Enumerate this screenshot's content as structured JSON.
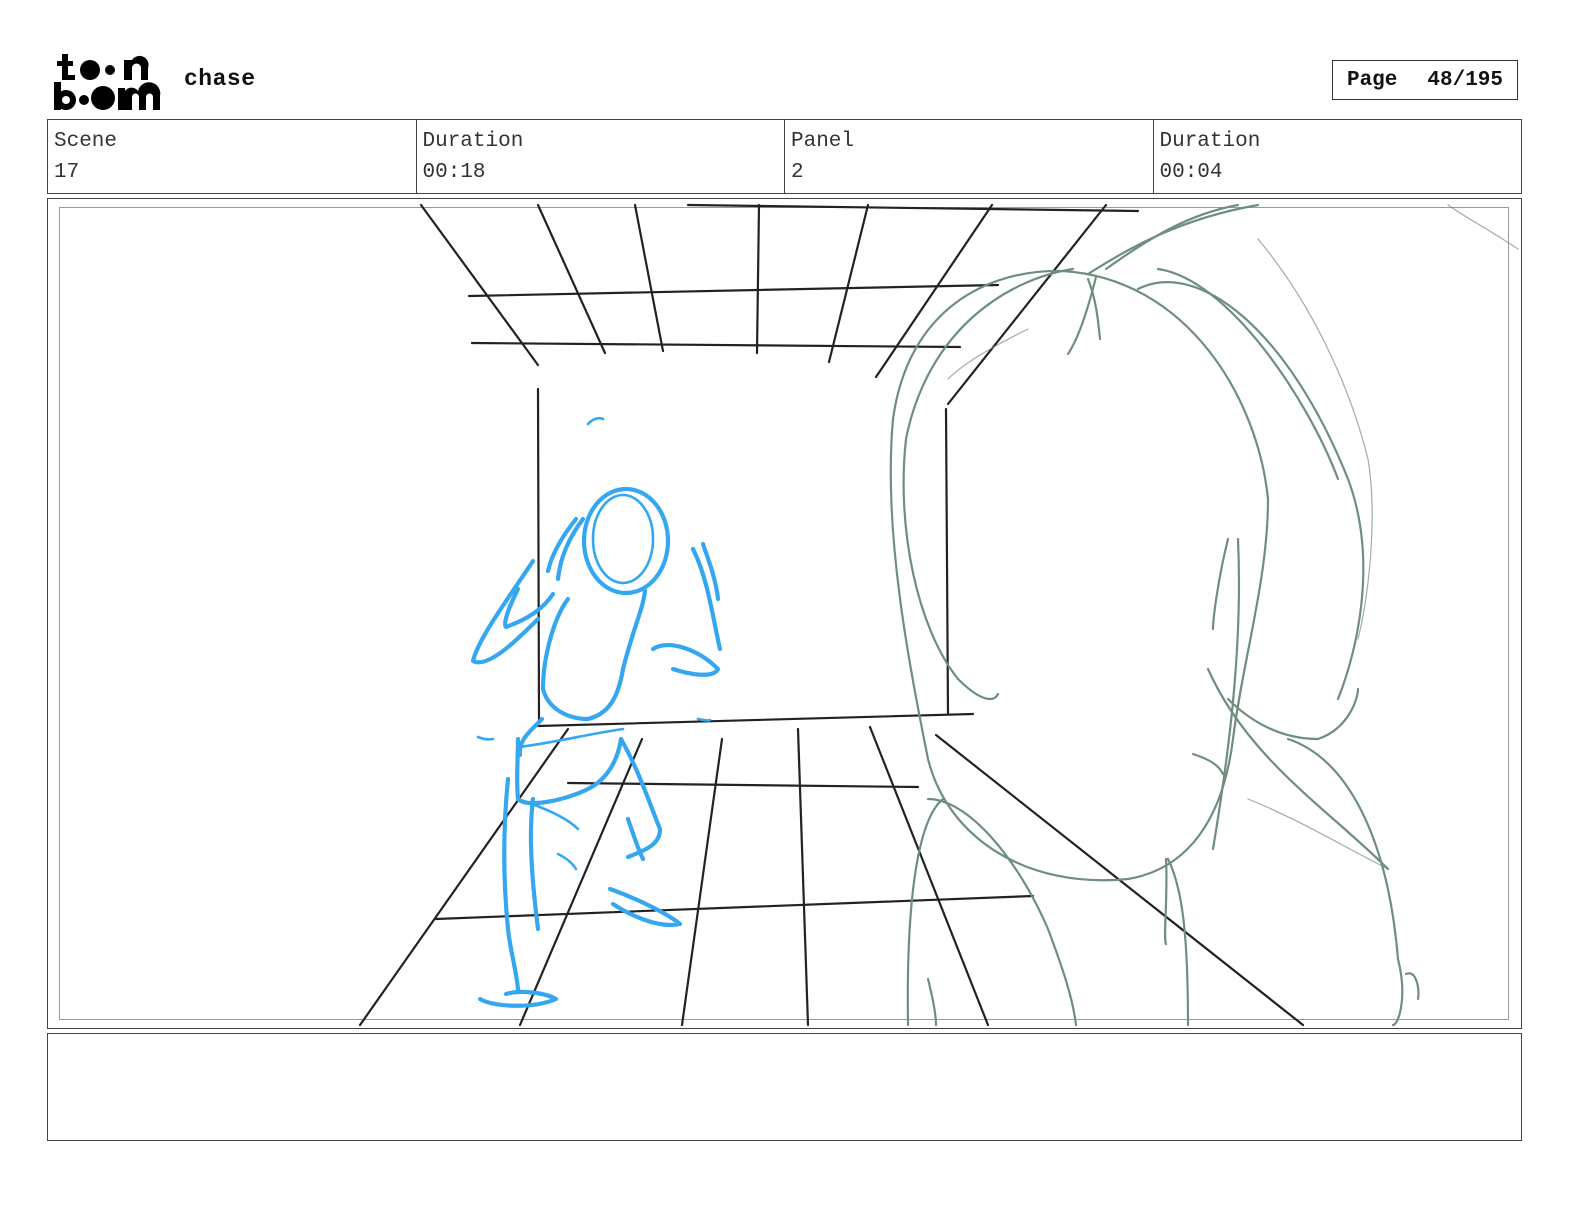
{
  "header": {
    "logo_text": "toon boom",
    "project_title": "chase",
    "page_label": "Page",
    "page_value": "48/195"
  },
  "info": {
    "scene_label": "Scene",
    "scene_value": "17",
    "scene_duration_label": "Duration",
    "scene_duration_value": "00:18",
    "panel_label": "Panel",
    "panel_value": "2",
    "panel_duration_label": "Duration",
    "panel_duration_value": "00:04"
  },
  "panel": {
    "colors": {
      "background_lines": "#222222",
      "character_sketch": "#35a7f0",
      "foreground_sketch": "#6f8f7e"
    }
  },
  "notes": {
    "text": ""
  }
}
